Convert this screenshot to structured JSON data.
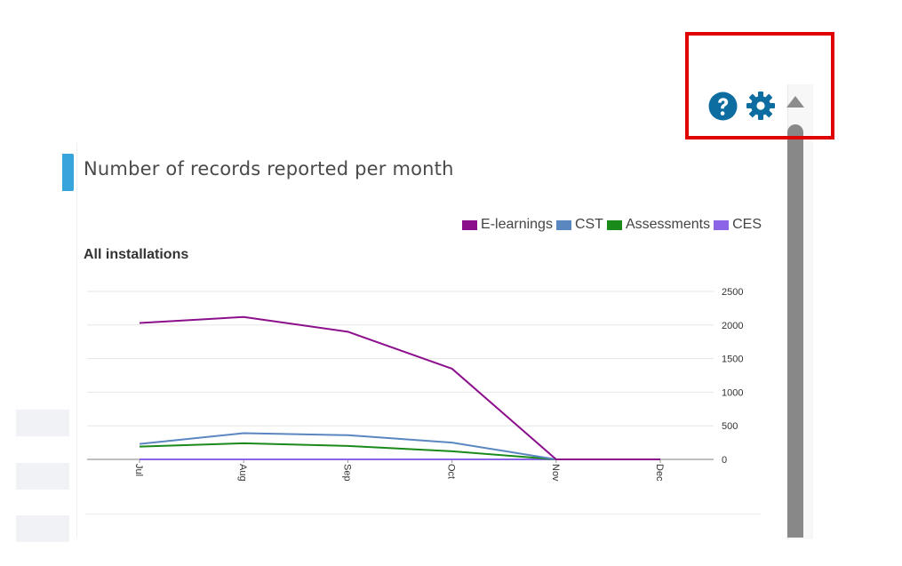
{
  "panel": {
    "title": "Number of records reported per month",
    "subtitle": "All installations"
  },
  "toolbar": {
    "help_icon": "help-circle-icon",
    "settings_icon": "gear-icon",
    "scroll_up_icon": "triangle-up-icon"
  },
  "colors": {
    "accent": "#37a4dc",
    "icon": "#0d6da1",
    "highlight": "#e10000",
    "scrollbar": "#888888"
  },
  "chart_data": {
    "type": "line",
    "title": "Number of records reported per month",
    "subtitle": "All installations",
    "categories": [
      "Jul",
      "Aug",
      "Sep",
      "Oct",
      "Nov",
      "Dec"
    ],
    "series": [
      {
        "name": "E-learnings",
        "color": "#8b0f8b",
        "values": [
          2030,
          2120,
          1900,
          1350,
          0,
          0
        ]
      },
      {
        "name": "CST",
        "color": "#5b87c0",
        "values": [
          230,
          390,
          360,
          250,
          0,
          0
        ]
      },
      {
        "name": "Assessments",
        "color": "#1a8a1a",
        "values": [
          190,
          240,
          200,
          120,
          0,
          0
        ]
      },
      {
        "name": "CES",
        "color": "#8c64e6",
        "values": [
          0,
          0,
          0,
          0,
          0,
          0
        ]
      }
    ],
    "y_ticks": [
      "0",
      "500",
      "1000",
      "1500",
      "2000",
      "2500"
    ],
    "ylim": [
      0,
      2500
    ],
    "y_axis_position": "right",
    "legend_position": "top-right",
    "grid": true
  }
}
